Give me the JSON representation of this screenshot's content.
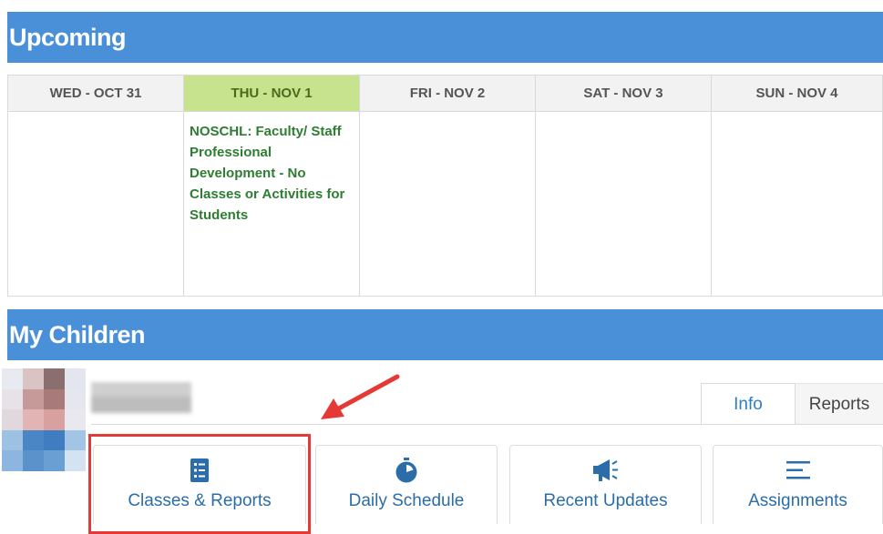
{
  "upcoming": {
    "title": "Upcoming",
    "days": [
      {
        "label": "WED - OCT 31",
        "events": []
      },
      {
        "label": "THU - NOV 1",
        "today": true,
        "events": [
          "NOSCHL: Faculty/ Staff Professional Development - No Classes or Activities for Students"
        ]
      },
      {
        "label": "FRI - NOV 2",
        "events": []
      },
      {
        "label": "SAT - NOV 3",
        "events": []
      },
      {
        "label": "SUN - NOV 4",
        "events": []
      }
    ]
  },
  "children": {
    "title": "My Children",
    "tabs": [
      {
        "label": "Info",
        "active": true
      },
      {
        "label": "Reports",
        "active": false
      }
    ],
    "tiles": [
      {
        "label": "Classes & Reports",
        "icon": "checklist-icon"
      },
      {
        "label": "Daily Schedule",
        "icon": "stopwatch-icon"
      },
      {
        "label": "Recent Updates",
        "icon": "megaphone-icon"
      },
      {
        "label": "Assignments",
        "icon": "list-lines-icon"
      }
    ]
  },
  "colors": {
    "header_blue": "#4a90d9",
    "today_green": "#c8e38e",
    "event_green": "#2e7d32",
    "link_blue": "#2b6da8",
    "annotation_red": "#e53935"
  }
}
